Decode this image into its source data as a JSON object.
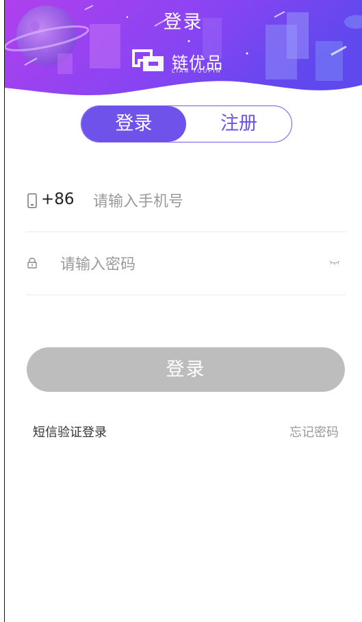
{
  "header": {
    "title": "登录",
    "logo_cn": "链优品",
    "logo_en": "LIAN YOUPIN",
    "gradient_start": "#a63ff0",
    "gradient_end": "#6a3ef0"
  },
  "tabs": [
    {
      "label": "登录",
      "active": true
    },
    {
      "label": "注册",
      "active": false
    }
  ],
  "form": {
    "phone_icon": "phone-icon",
    "country_code": "+86",
    "phone_placeholder": "请输入手机号",
    "lock_icon": "lock-icon",
    "password_placeholder": "请输入密码",
    "eye_icon": "eye-closed-icon"
  },
  "actions": {
    "login_label": "登录",
    "sms_login": "短信验证登录",
    "forgot_password": "忘记密码"
  },
  "colors": {
    "accent": "#6e52ea",
    "button_disabled": "#bdbdbd"
  }
}
